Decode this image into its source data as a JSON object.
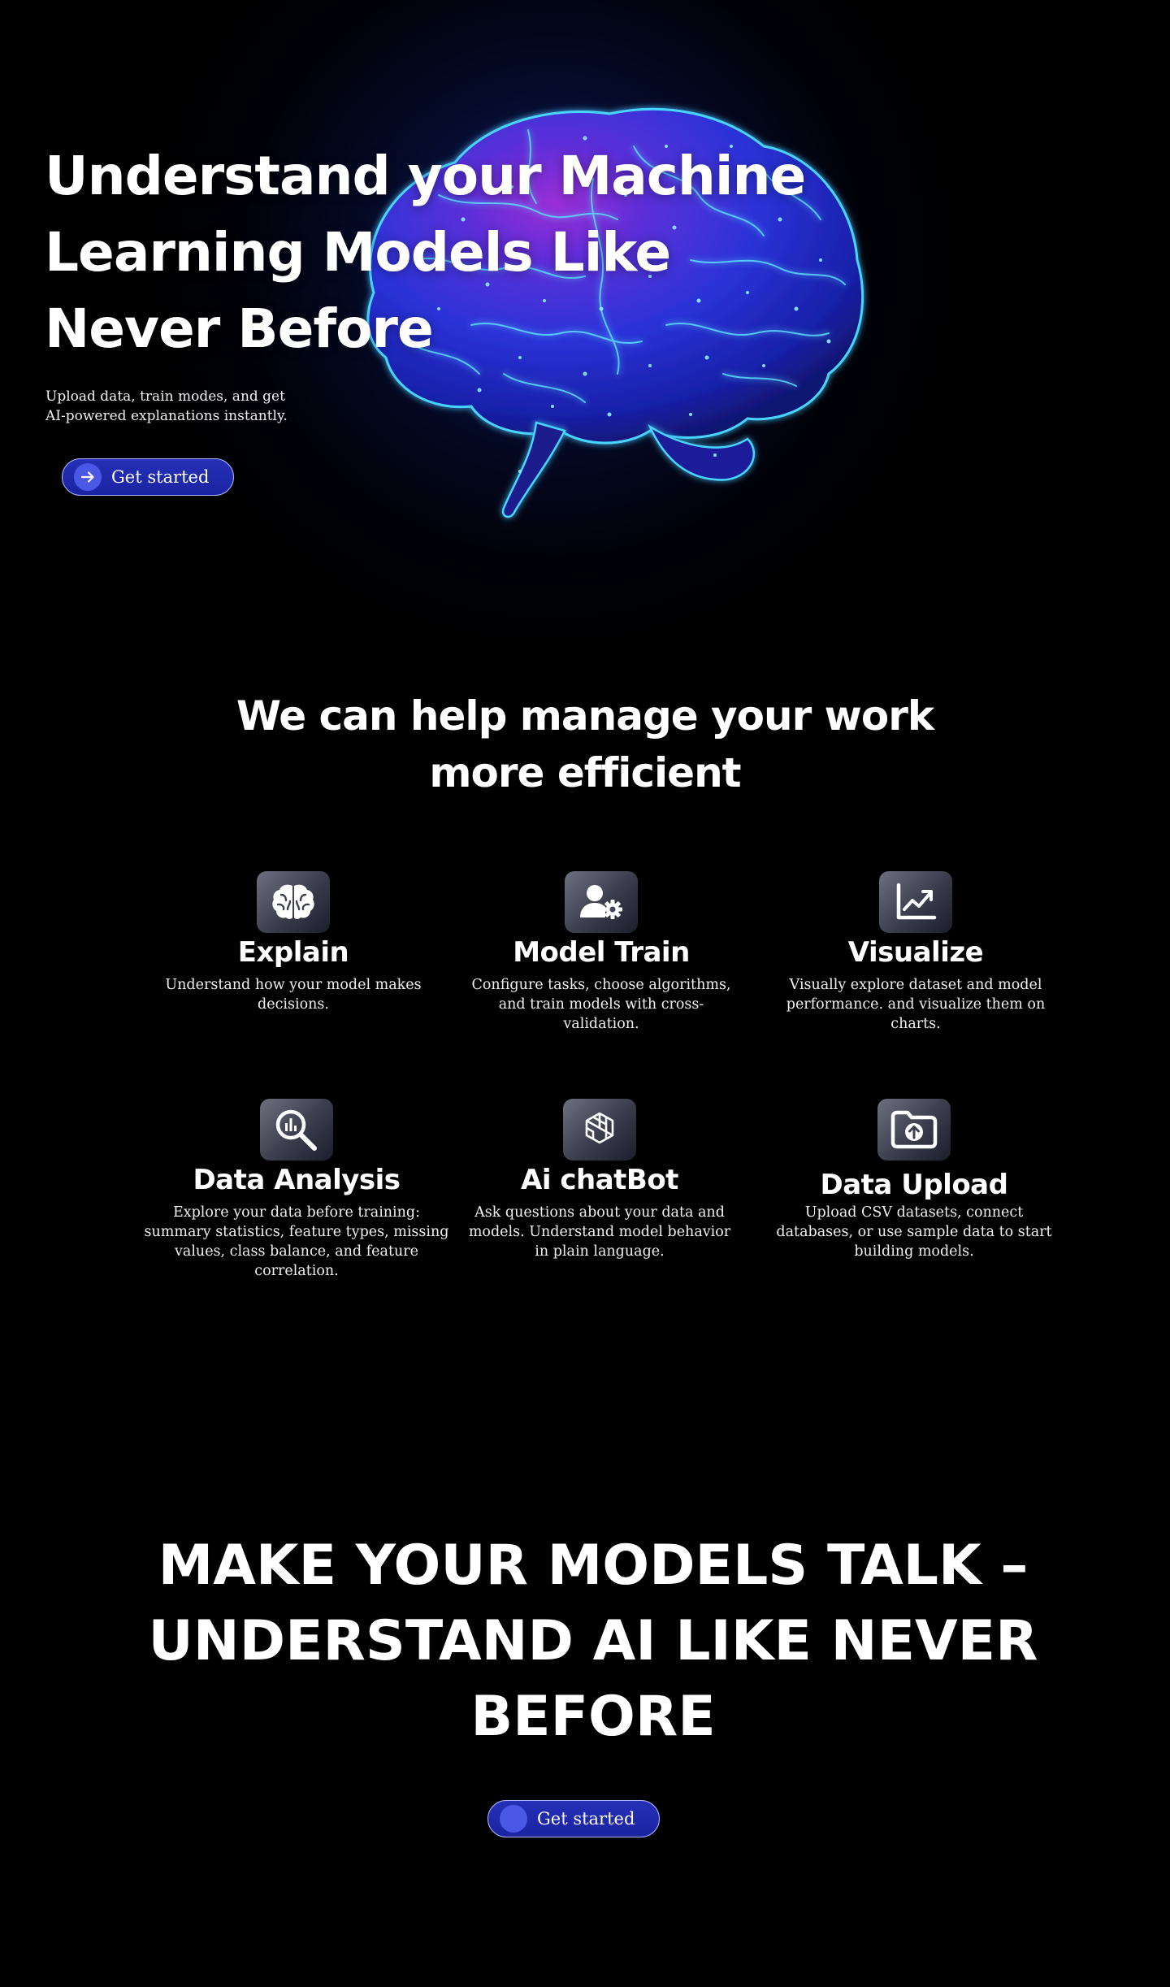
{
  "hero": {
    "title": "Understand your Machine Learning Models Like Never Before",
    "subtitle": "Upload data, train modes, and get AI-powered explanations instantly.",
    "cta_label": "Get started",
    "cta_icon": "arrow-right-icon",
    "background_image": "glowing-brain-illustration"
  },
  "services": {
    "heading_line1": "We can help manage your work",
    "heading_line2": "more efficient",
    "items": [
      {
        "icon": "brain-icon",
        "title": "Explain",
        "description": "Understand how your model makes decisions."
      },
      {
        "icon": "user-gear-icon",
        "title": "Model Train",
        "description": "Configure tasks, choose algorithms, and train models with cross-validation."
      },
      {
        "icon": "line-chart-icon",
        "title": "Visualize",
        "description": "Visually explore dataset and model performance. and visualize them on charts."
      },
      {
        "icon": "magnifier-chart-icon",
        "title": "Data Analysis",
        "description": "Explore your data before training: summary statistics, feature types, missing values, class balance, and feature correlation."
      },
      {
        "icon": "openai-knot-icon",
        "title": "Ai chatBot",
        "description": "Ask questions about your data and models. Understand model behavior in plain language."
      },
      {
        "icon": "folder-upload-icon",
        "title": "Data Upload",
        "description": "Upload CSV datasets, connect databases, or use sample data to start building models."
      }
    ]
  },
  "closing": {
    "tagline": "MAKE YOUR MODELS TALK – UNDERSTAND AI LIKE NEVER BEFORE",
    "cta_label": "Get started"
  },
  "colors": {
    "background": "#000000",
    "button_fill": "#1f29ad",
    "button_border": "#aeb6ff",
    "button_dot": "#4b58e6",
    "glow_blue": "#1e3cc8",
    "brain_cyan": "#35d6ff",
    "brain_magenta": "#b02cd0"
  }
}
